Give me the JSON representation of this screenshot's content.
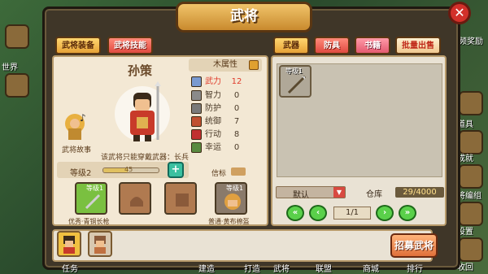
{
  "window": {
    "title": "武将",
    "close": "✕"
  },
  "tabs_left": [
    "武将装备",
    "武将技能"
  ],
  "tabs_right": [
    "武器",
    "防具",
    "书籍",
    "批量出售"
  ],
  "hero": {
    "name": "孙策",
    "attribute_type": "木属性",
    "story_label": "武将故事",
    "weapon_note": "该武将只能穿戴武器：长兵",
    "level_label": "等级2",
    "level_progress_text": "45",
    "level_progress": 0.45,
    "fame_label": "信标"
  },
  "attributes": [
    {
      "label": "武力",
      "value": "12",
      "color": "#7a9ad0"
    },
    {
      "label": "智力",
      "value": "0",
      "color": "#8a8a8a"
    },
    {
      "label": "防护",
      "value": "0",
      "color": "#7a7a7a"
    },
    {
      "label": "统御",
      "value": "7",
      "color": "#c05030"
    },
    {
      "label": "行动",
      "value": "8",
      "color": "#c03030"
    },
    {
      "label": "幸运",
      "value": "0",
      "color": "#5a8a40"
    }
  ],
  "equip_slots": [
    {
      "caption": "优秀·青铜长枪",
      "level": "等级1"
    },
    {
      "caption": "",
      "level": ""
    },
    {
      "caption": "",
      "level": ""
    },
    {
      "caption": "普通·黄布棉盔",
      "level": "等级1"
    }
  ],
  "inventory": {
    "item_level": "等级1",
    "filter": "默认",
    "warehouse_label": "仓库",
    "warehouse_count": "29/4000",
    "page": "1/1"
  },
  "recruit_button": "招募武将",
  "side_left": [
    "世界"
  ],
  "side_right": [
    "视频奖励",
    "道具",
    "成就",
    "武将编组",
    "设置",
    "收回"
  ],
  "bottom_nav": [
    "任务",
    "建造",
    "打造",
    "武将",
    "联盟",
    "商城",
    "排行"
  ]
}
